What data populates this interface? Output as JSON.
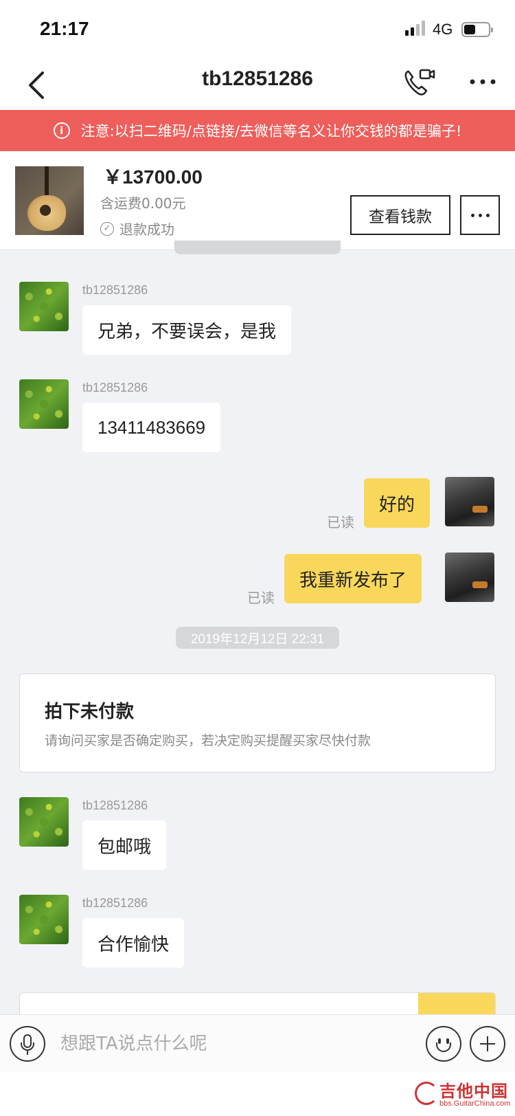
{
  "status_bar": {
    "time": "21:17",
    "network": "4G"
  },
  "header": {
    "title": "tb12851286"
  },
  "warning": {
    "icon": "info-icon",
    "text": "注意:以扫二维码/点链接/去微信等名义让你交钱的都是骗子!"
  },
  "product": {
    "price": "￥13700.00",
    "shipping": "含运费0.00元",
    "status": "退款成功",
    "view_button": "查看钱款"
  },
  "messages": [
    {
      "sender": "tb12851286",
      "text": "兄弟，不要误会，是我"
    },
    {
      "sender": "tb12851286",
      "text": "13411483669"
    },
    {
      "text": "好的",
      "read": "已读"
    },
    {
      "text": "我重新发布了",
      "read": "已读"
    },
    {
      "sender": "tb12851286",
      "text": "包邮哦"
    },
    {
      "sender": "tb12851286",
      "text": "合作愉快"
    }
  ],
  "timestamp": "2019年12月12日 22:31",
  "system_card": {
    "title": "拍下未付款",
    "description": "请询问买家是否确定购买，若决定购买提醒买家尽快付款"
  },
  "input": {
    "placeholder": "想跟TA说点什么呢"
  },
  "watermark": {
    "main": "吉他中国",
    "sub": "bbs.GuitarChina.com"
  },
  "colors": {
    "warning_bg": "#ee5e5b",
    "my_bubble": "#f8d75b",
    "chat_bg": "#f1f2f6"
  }
}
